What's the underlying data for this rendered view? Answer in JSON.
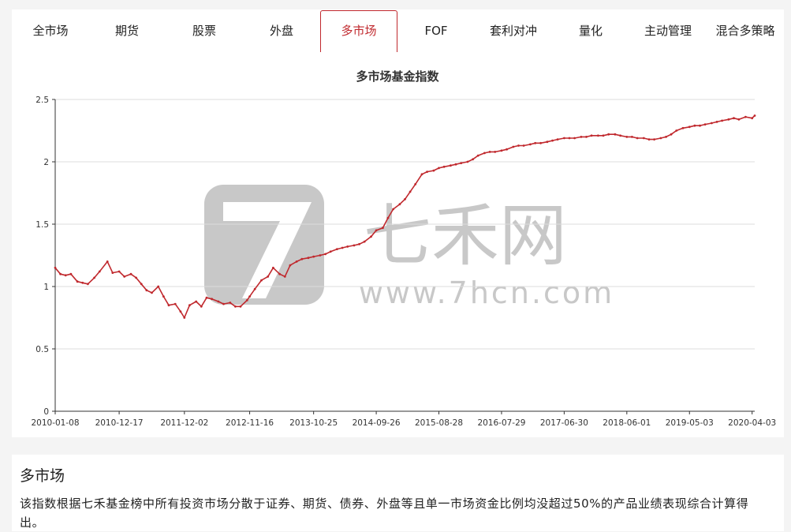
{
  "tabs": [
    {
      "label": "全市场",
      "active": false
    },
    {
      "label": "期货",
      "active": false
    },
    {
      "label": "股票",
      "active": false
    },
    {
      "label": "外盘",
      "active": false
    },
    {
      "label": "多市场",
      "active": true
    },
    {
      "label": "FOF",
      "active": false
    },
    {
      "label": "套利对冲",
      "active": false
    },
    {
      "label": "量化",
      "active": false
    },
    {
      "label": "主动管理",
      "active": false
    },
    {
      "label": "混合多策略",
      "active": false
    }
  ],
  "watermark": {
    "brand": "七禾网",
    "url": "www.7hcn.com"
  },
  "description": {
    "title": "多市场",
    "text": "该指数根据七禾基金榜中所有投资市场分散于证券、期货、债券、外盘等且单一市场资金比例均没超过50%的产品业绩表现综合计算得出。"
  },
  "colors": {
    "accent": "#c0282d",
    "line": "#c0282d",
    "grid": "#dddddd"
  },
  "chart_data": {
    "type": "line",
    "title": "多市场基金指数",
    "xlabel": "",
    "ylabel": "",
    "ylim": [
      0,
      2.5
    ],
    "yticks": [
      "0",
      "0.5",
      "1",
      "1.5",
      "2",
      "2.5"
    ],
    "xticks": [
      "2010-01-08",
      "2010-12-17",
      "2011-12-02",
      "2012-11-16",
      "2013-10-25",
      "2014-09-26",
      "2015-08-28",
      "2016-07-29",
      "2017-06-30",
      "2018-06-01",
      "2019-05-03",
      "2020-04-03"
    ],
    "grid": true,
    "legend": "none",
    "series": [
      {
        "x": [
          "2010-01-08",
          "2010-02-05",
          "2010-03-05",
          "2010-04-02",
          "2010-05-07",
          "2010-06-04",
          "2010-07-02",
          "2010-08-06",
          "2010-09-03",
          "2010-10-15",
          "2010-11-12",
          "2010-12-17",
          "2011-01-14",
          "2011-02-18",
          "2011-03-18",
          "2011-04-15",
          "2011-05-13",
          "2011-06-10",
          "2011-07-15",
          "2011-08-12",
          "2011-09-09",
          "2011-10-14",
          "2011-11-11",
          "2011-12-02",
          "2011-12-30",
          "2012-02-03",
          "2012-03-02",
          "2012-03-30",
          "2012-04-27",
          "2012-06-01",
          "2012-06-29",
          "2012-08-03",
          "2012-08-31",
          "2012-09-28",
          "2012-11-02",
          "2012-11-16",
          "2012-12-14",
          "2013-01-18",
          "2013-02-22",
          "2013-03-22",
          "2013-04-26",
          "2013-05-24",
          "2013-06-21",
          "2013-07-26",
          "2013-08-23",
          "2013-09-27",
          "2013-10-25",
          "2013-11-29",
          "2013-12-27",
          "2014-01-24",
          "2014-02-28",
          "2014-03-28",
          "2014-04-25",
          "2014-05-30",
          "2014-06-27",
          "2014-07-25",
          "2014-08-29",
          "2014-09-26",
          "2014-10-31",
          "2014-11-28",
          "2014-12-26",
          "2015-01-30",
          "2015-02-27",
          "2015-03-27",
          "2015-04-24",
          "2015-05-29",
          "2015-06-26",
          "2015-07-31",
          "2015-08-28",
          "2015-09-25",
          "2015-10-30",
          "2015-11-27",
          "2015-12-25",
          "2016-01-29",
          "2016-02-26",
          "2016-03-25",
          "2016-04-29",
          "2016-05-27",
          "2016-06-24",
          "2016-07-29",
          "2016-08-26",
          "2016-09-30",
          "2016-10-28",
          "2016-11-25",
          "2016-12-30",
          "2017-01-26",
          "2017-02-24",
          "2017-03-31",
          "2017-04-28",
          "2017-05-26",
          "2017-06-30",
          "2017-07-28",
          "2017-08-25",
          "2017-09-29",
          "2017-10-27",
          "2017-11-24",
          "2017-12-29",
          "2018-01-26",
          "2018-02-23",
          "2018-03-30",
          "2018-04-27",
          "2018-06-01",
          "2018-06-29",
          "2018-07-27",
          "2018-08-31",
          "2018-09-28",
          "2018-10-26",
          "2018-11-30",
          "2018-12-28",
          "2019-01-25",
          "2019-02-22",
          "2019-03-29",
          "2019-05-03",
          "2019-05-31",
          "2019-06-28",
          "2019-07-26",
          "2019-08-30",
          "2019-09-27",
          "2019-10-25",
          "2019-11-29",
          "2019-12-27",
          "2020-01-23",
          "2020-02-28",
          "2020-04-03",
          "2020-04-17"
        ],
        "values": [
          1.15,
          1.1,
          1.09,
          1.1,
          1.04,
          1.03,
          1.02,
          1.07,
          1.12,
          1.2,
          1.11,
          1.12,
          1.08,
          1.1,
          1.07,
          1.02,
          0.97,
          0.95,
          1.0,
          0.92,
          0.85,
          0.86,
          0.8,
          0.75,
          0.85,
          0.88,
          0.84,
          0.91,
          0.9,
          0.88,
          0.86,
          0.87,
          0.84,
          0.84,
          0.89,
          0.92,
          0.98,
          1.05,
          1.08,
          1.15,
          1.1,
          1.08,
          1.17,
          1.2,
          1.22,
          1.23,
          1.24,
          1.25,
          1.26,
          1.28,
          1.3,
          1.31,
          1.32,
          1.33,
          1.34,
          1.36,
          1.4,
          1.45,
          1.47,
          1.55,
          1.62,
          1.66,
          1.7,
          1.76,
          1.82,
          1.9,
          1.92,
          1.93,
          1.95,
          1.96,
          1.97,
          1.98,
          1.99,
          2.0,
          2.02,
          2.05,
          2.07,
          2.08,
          2.08,
          2.09,
          2.1,
          2.12,
          2.13,
          2.13,
          2.14,
          2.15,
          2.15,
          2.16,
          2.17,
          2.18,
          2.19,
          2.19,
          2.19,
          2.2,
          2.2,
          2.21,
          2.21,
          2.21,
          2.22,
          2.22,
          2.21,
          2.2,
          2.2,
          2.19,
          2.19,
          2.18,
          2.18,
          2.19,
          2.2,
          2.22,
          2.25,
          2.27,
          2.28,
          2.29,
          2.29,
          2.3,
          2.31,
          2.32,
          2.33,
          2.34,
          2.35,
          2.34,
          2.36,
          2.35,
          2.37
        ]
      }
    ]
  }
}
